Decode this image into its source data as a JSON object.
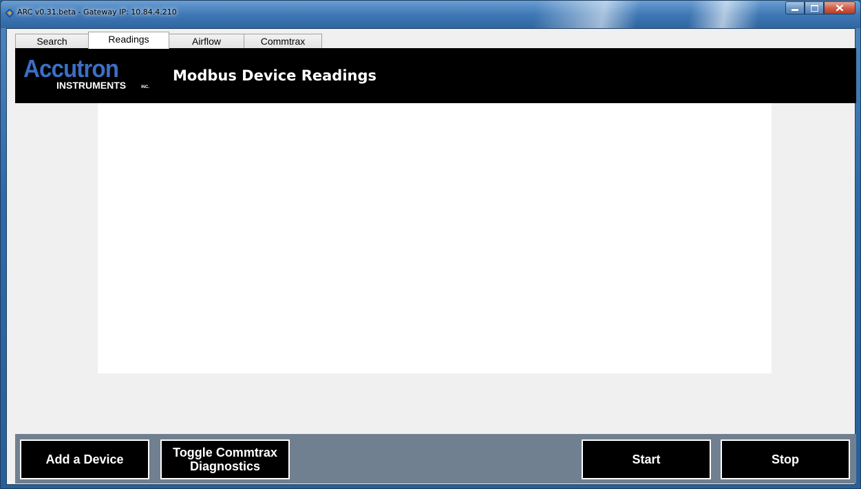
{
  "window": {
    "title": "ARC v0.31.beta - Gateway IP: 10.84.4.210"
  },
  "tabs": [
    {
      "label": "Search",
      "active": false
    },
    {
      "label": "Readings",
      "active": true
    },
    {
      "label": "Airflow",
      "active": false
    },
    {
      "label": "Commtrax",
      "active": false
    }
  ],
  "header": {
    "logo_main": "Accutron",
    "logo_sub": "INSTRUMENTS",
    "logo_inc": "INC.",
    "title": "Modbus Device Readings"
  },
  "actions": {
    "add_device": "Add a Device",
    "toggle_diagnostics": "Toggle Commtrax\nDiagnostics",
    "start": "Start",
    "stop": "Stop"
  },
  "colors": {
    "header_bg": "#000000",
    "logo_blue": "#3a6fc4",
    "bottom_bar": "#718090",
    "button_bg": "#000000"
  },
  "icons": {
    "app": "arc-app-icon",
    "minimize": "minimize-icon",
    "maximize": "maximize-icon",
    "close": "close-icon"
  }
}
